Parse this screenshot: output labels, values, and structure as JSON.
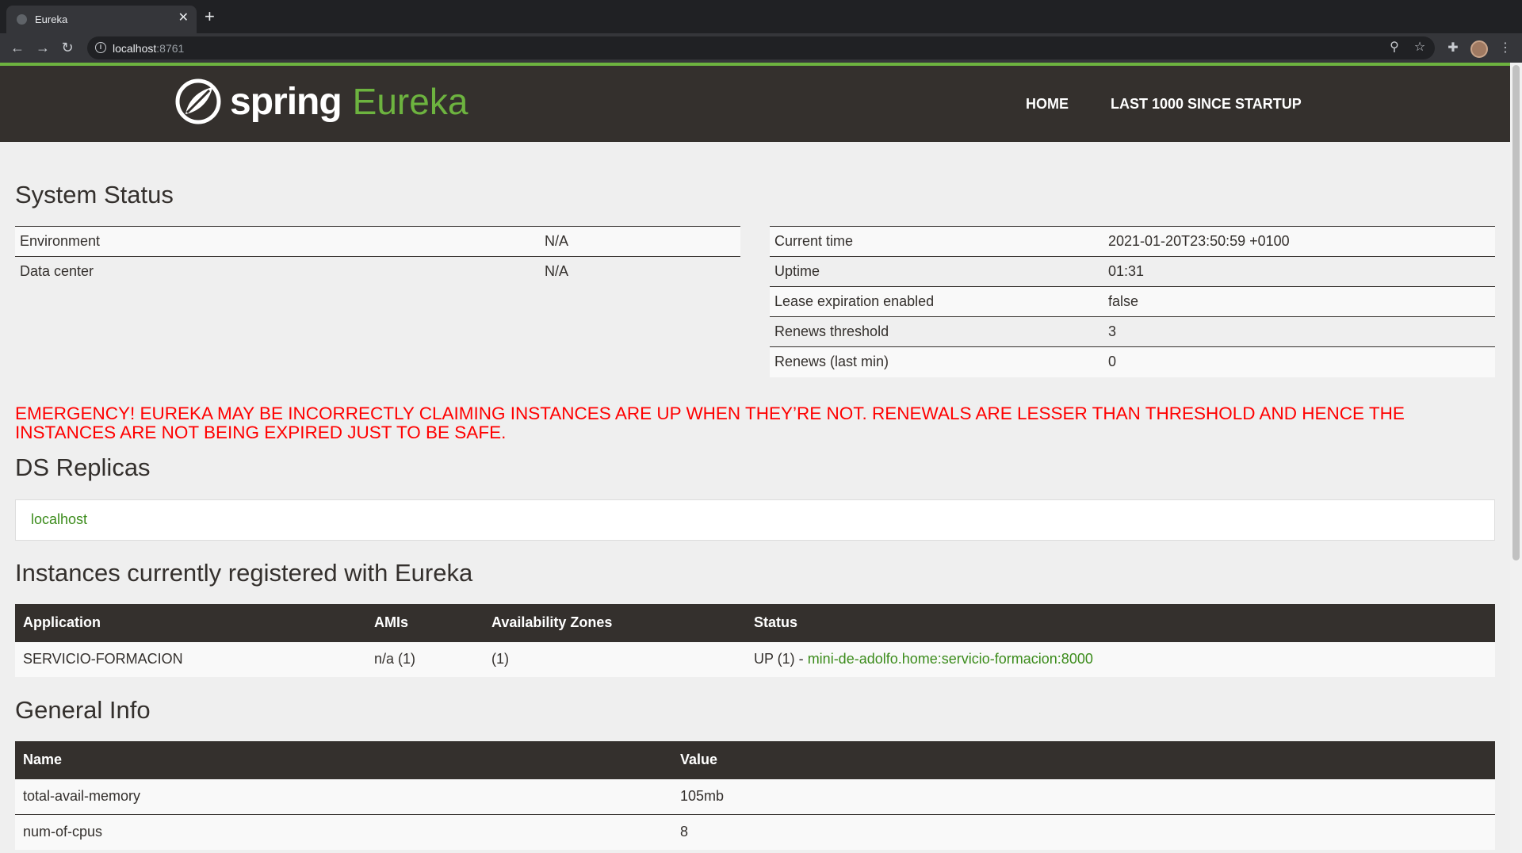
{
  "browser": {
    "tab_title": "Eureka",
    "tab_close": "✕",
    "new_tab": "+",
    "url_host": "localhost",
    "url_port": ":8761",
    "icons": [
      "back-arrow-icon",
      "forward-arrow-icon",
      "reload-icon",
      "info-icon",
      "zoom-icon",
      "star-icon",
      "extensions-icon",
      "profile-avatar",
      "kebab-menu-icon"
    ]
  },
  "header": {
    "brand_spring": "spring",
    "brand_eureka": "Eureka",
    "nav_home": "HOME",
    "nav_last1000": "LAST 1000 SINCE STARTUP",
    "accent_color": "#6db33f",
    "bar_color": "#34302d"
  },
  "system_status": {
    "title": "System Status",
    "left": [
      {
        "key": "Environment",
        "value": "N/A"
      },
      {
        "key": "Data center",
        "value": "N/A"
      }
    ],
    "right": [
      {
        "key": "Current time",
        "value": "2021-01-20T23:50:59 +0100"
      },
      {
        "key": "Uptime",
        "value": "01:31"
      },
      {
        "key": "Lease expiration enabled",
        "value": "false"
      },
      {
        "key": "Renews threshold",
        "value": "3"
      },
      {
        "key": "Renews (last min)",
        "value": "0"
      }
    ]
  },
  "emergency": {
    "text": "EMERGENCY! EUREKA MAY BE INCORRECTLY CLAIMING INSTANCES ARE UP WHEN THEY’RE NOT. RENEWALS ARE LESSER THAN THRESHOLD AND HENCE THE INSTANCES ARE NOT BEING EXPIRED JUST TO BE SAFE.",
    "color": "#ff0000"
  },
  "ds_replicas": {
    "title": "DS Replicas",
    "items": [
      "localhost"
    ]
  },
  "instances": {
    "title": "Instances currently registered with Eureka",
    "headers": [
      "Application",
      "AMIs",
      "Availability Zones",
      "Status"
    ],
    "rows": [
      {
        "application": "SERVICIO-FORMACION",
        "amis": "n/a (1)",
        "zones": "(1)",
        "status_prefix": "UP (1) - ",
        "status_link": "mini-de-adolfo.home:servicio-formacion:8000"
      }
    ]
  },
  "general_info": {
    "title": "General Info",
    "headers": [
      "Name",
      "Value"
    ],
    "rows": [
      {
        "name": "total-avail-memory",
        "value": "105mb"
      },
      {
        "name": "num-of-cpus",
        "value": "8"
      }
    ]
  }
}
